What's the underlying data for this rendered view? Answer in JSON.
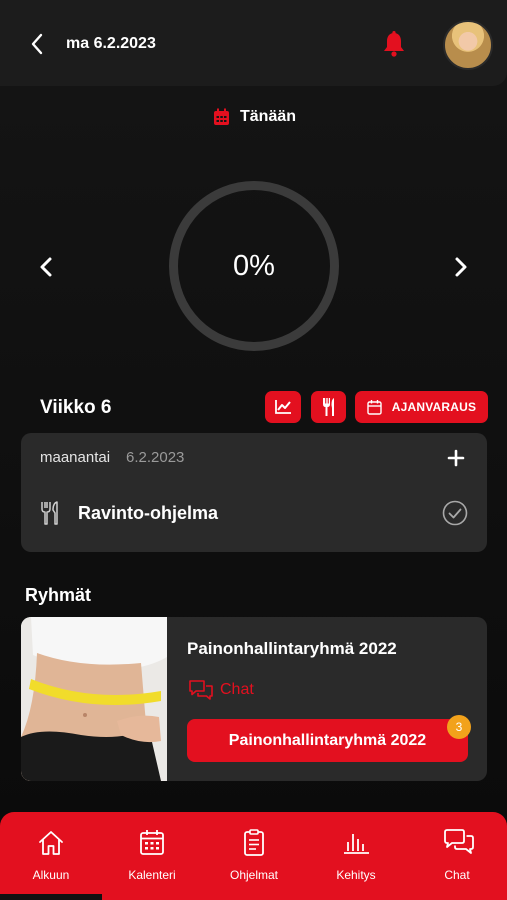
{
  "header": {
    "date": "ma 6.2.2023"
  },
  "today": {
    "label": "Tänään"
  },
  "progress": {
    "value": "0%"
  },
  "week": {
    "title": "Viikko 6",
    "booking_label": "AJANVARAUS"
  },
  "day": {
    "name": "maanantai",
    "date": "6.2.2023",
    "program": {
      "label": "Ravinto-ohjelma"
    }
  },
  "groups": {
    "title": "Ryhmät",
    "items": [
      {
        "name": "Painonhallintaryhmä 2022",
        "chat_label": "Chat",
        "button_label": "Painonhallintaryhmä 2022",
        "badge": "3"
      }
    ]
  },
  "tabbar": {
    "tabs": [
      {
        "label": "Alkuun",
        "icon": "home-icon"
      },
      {
        "label": "Kalenteri",
        "icon": "calendar-icon"
      },
      {
        "label": "Ohjelmat",
        "icon": "clipboard-icon"
      },
      {
        "label": "Kehitys",
        "icon": "bar-chart-icon"
      },
      {
        "label": "Chat",
        "icon": "chat-icon"
      }
    ]
  },
  "colors": {
    "accent": "#e3101f",
    "badge": "#f2a21b",
    "card": "#2a2a2a"
  }
}
